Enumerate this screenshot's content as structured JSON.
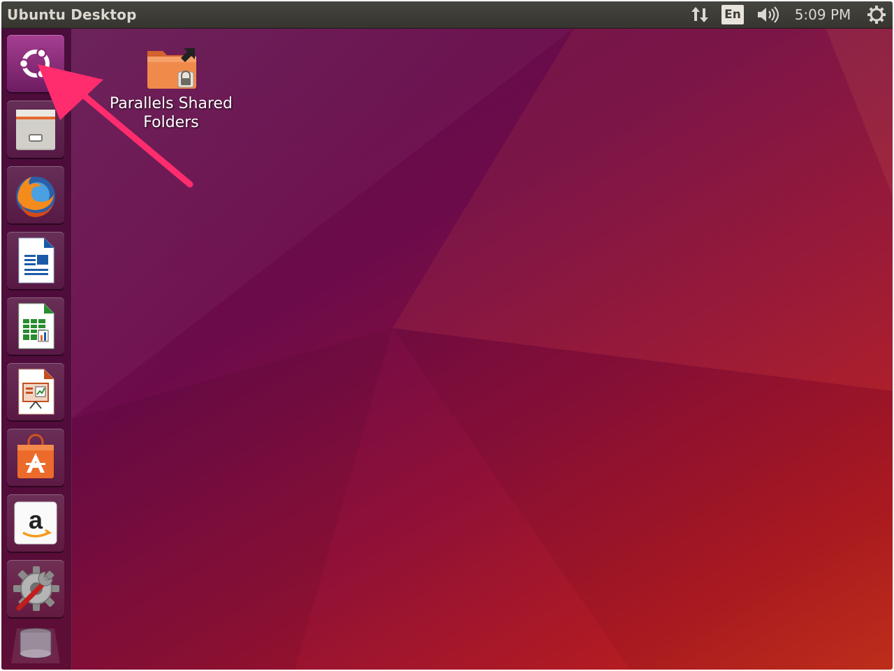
{
  "topbar": {
    "window_title": "Ubuntu Desktop",
    "keyboard_layout": "En",
    "clock": "5:09 PM",
    "icons": [
      "network-transfer-icon",
      "volume-icon",
      "session-gear-icon"
    ]
  },
  "launcher": {
    "items": [
      {
        "name": "dash-ubuntu-icon"
      },
      {
        "name": "files-icon"
      },
      {
        "name": "firefox-icon"
      },
      {
        "name": "libreoffice-writer-icon"
      },
      {
        "name": "libreoffice-calc-icon"
      },
      {
        "name": "libreoffice-impress-icon"
      },
      {
        "name": "ubuntu-software-icon"
      },
      {
        "name": "amazon-icon"
      },
      {
        "name": "system-settings-icon"
      },
      {
        "name": "trash-icon"
      }
    ],
    "amazon_letter": "a"
  },
  "desktop": {
    "icons": [
      {
        "label_line1": "Parallels Shared",
        "label_line2": "Folders"
      }
    ]
  },
  "annotation": {
    "color": "#ff2d6e"
  }
}
